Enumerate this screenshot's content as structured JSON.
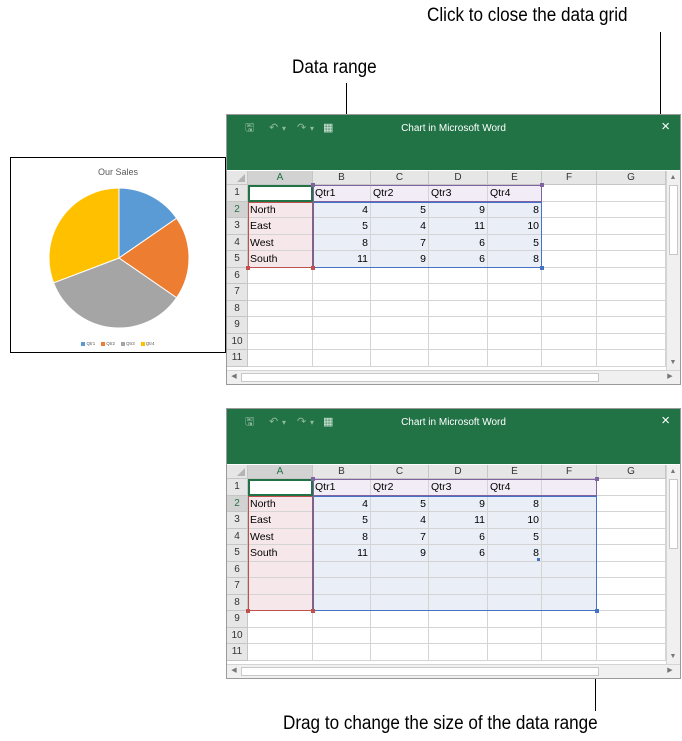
{
  "callouts": {
    "close_grid": "Click to close the data grid",
    "data_range": "Data range",
    "drag_resize": "Drag to change the size of the data range"
  },
  "window": {
    "title": "Chart in Microsoft Word",
    "close_glyph": "×",
    "save_glyph": "🖫",
    "undo_glyph": "↶",
    "redo_glyph": "↷",
    "dropdown_glyph": "▾",
    "edit_data_glyph": "▦"
  },
  "columns": [
    "A",
    "B",
    "C",
    "D",
    "E",
    "F",
    "G"
  ],
  "rows": [
    "1",
    "2",
    "3",
    "4",
    "5",
    "6",
    "7",
    "8",
    "9",
    "10",
    "11"
  ],
  "sheet": {
    "headers": [
      "",
      "Qtr1",
      "Qtr2",
      "Qtr3",
      "Qtr4"
    ],
    "data": [
      {
        "label": "North",
        "values": [
          "4",
          "5",
          "9",
          "8"
        ]
      },
      {
        "label": "East",
        "values": [
          "5",
          "4",
          "11",
          "10"
        ]
      },
      {
        "label": "West",
        "values": [
          "8",
          "7",
          "6",
          "5"
        ]
      },
      {
        "label": "South",
        "values": [
          "11",
          "9",
          "6",
          "8"
        ]
      }
    ]
  },
  "chart_data": {
    "type": "pie",
    "title": "Our Sales",
    "categories": [
      "Qtr1",
      "Qtr2",
      "Qtr3",
      "Qtr4"
    ],
    "values": [
      4,
      5,
      9,
      8
    ],
    "colors": [
      "#5b9bd5",
      "#ed7d31",
      "#a5a5a5",
      "#ffc000"
    ],
    "legend_position": "bottom"
  },
  "colors": {
    "excel_green": "#217346",
    "range_purple": "#8064a2",
    "range_red": "#c0504d",
    "range_blue": "#4472c4"
  }
}
